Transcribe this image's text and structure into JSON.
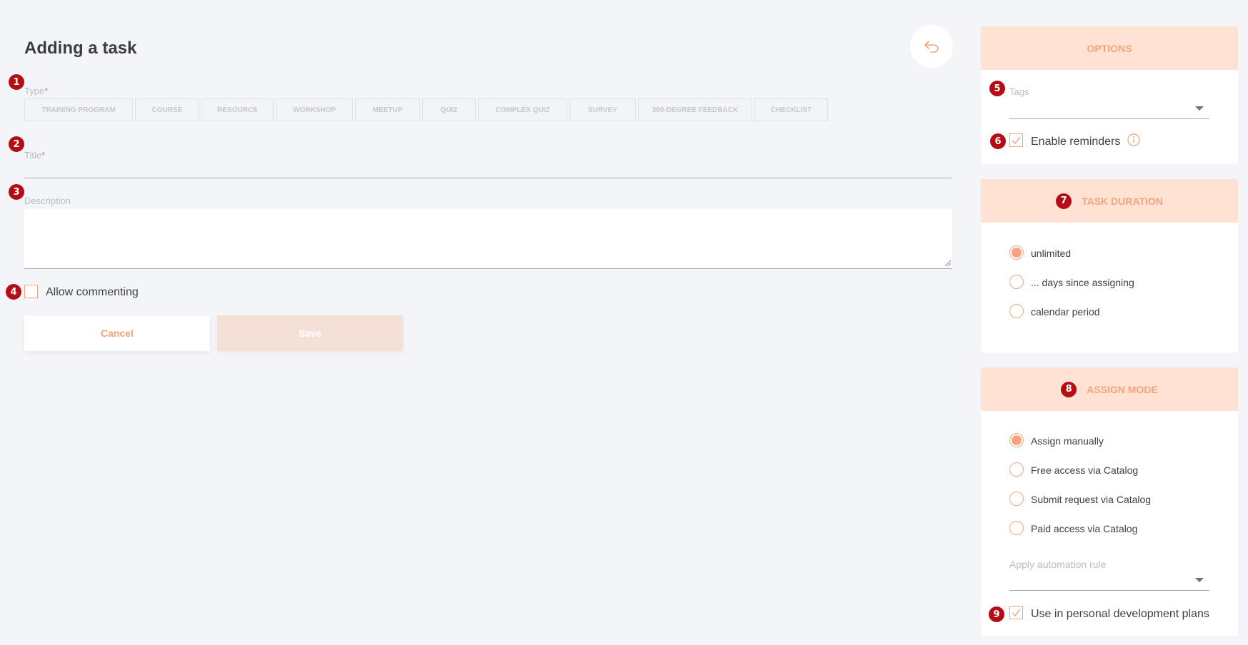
{
  "page": {
    "title": "Adding a task"
  },
  "markers": [
    "1",
    "2",
    "3",
    "4",
    "5",
    "6",
    "7",
    "8",
    "9"
  ],
  "form": {
    "type_label": "Type",
    "required_mark": "*",
    "types": [
      "TRAINING PROGRAM",
      "COURSE",
      "RESOURCE",
      "WORKSHOP",
      "MEETUP",
      "QUIZ",
      "COMPLEX QUIZ",
      "SURVEY",
      "360-DEGREE FEEDBACK",
      "CHECKLIST"
    ],
    "title_label": "Title",
    "title_value": "",
    "description_label": "Description",
    "description_value": "",
    "allow_commenting_label": "Allow commenting",
    "allow_commenting_checked": false,
    "cancel_label": "Cancel",
    "save_label": "Save"
  },
  "options": {
    "header": "OPTIONS",
    "tags_label": "Tags",
    "tags_value": "",
    "enable_reminders_label": "Enable reminders",
    "enable_reminders_checked": true
  },
  "task_duration": {
    "header": "TASK DURATION",
    "options": [
      "unlimited",
      "... days since assigning",
      "calendar period"
    ],
    "selected": "unlimited"
  },
  "assign_mode": {
    "header": "ASSIGN MODE",
    "options": [
      "Assign manually",
      "Free access via Catalog",
      "Submit request via Catalog",
      "Paid access via Catalog"
    ],
    "selected": "Assign manually",
    "automation_rule_label": "Apply automation rule",
    "automation_rule_value": "",
    "pdp_label": "Use in personal development plans",
    "pdp_checked": true
  },
  "colors": {
    "accent": "#f2a47c",
    "panel_header_bg": "#ffe2d3",
    "marker": "#b50d14",
    "save_disabled_bg": "#f5e0d7",
    "background": "#f4f5f9"
  }
}
